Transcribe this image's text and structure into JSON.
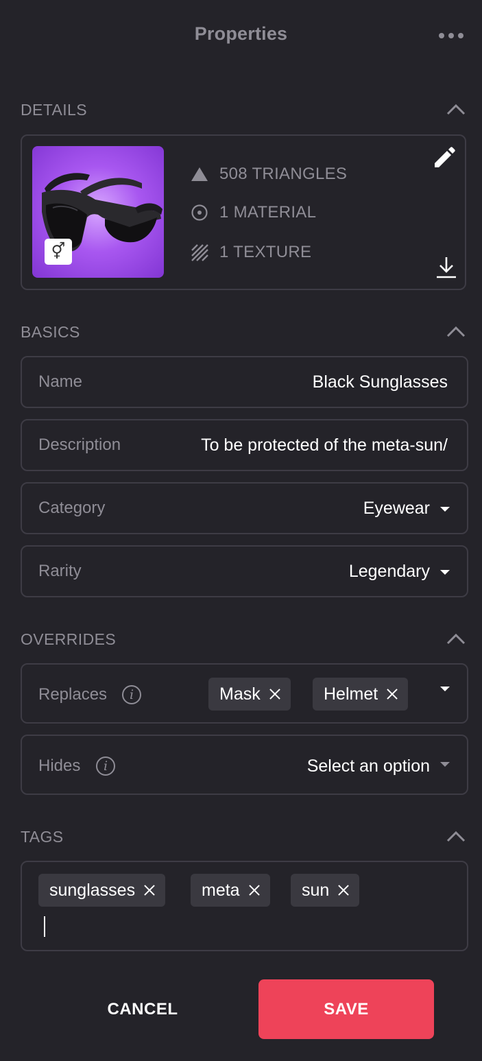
{
  "header": {
    "title": "Properties",
    "more_icon": "more-horizontal-icon"
  },
  "details": {
    "label": "DETAILS",
    "gender_symbol": "⚥",
    "stats": [
      {
        "icon": "triangle-icon",
        "text": "508 TRIANGLES"
      },
      {
        "icon": "material-icon",
        "text": "1 MATERIAL"
      },
      {
        "icon": "texture-icon",
        "text": "1 TEXTURE"
      }
    ],
    "edit_icon": "pencil-icon",
    "download_icon": "download-icon"
  },
  "basics": {
    "label": "BASICS",
    "name": {
      "label": "Name",
      "value": "Black Sunglasses"
    },
    "description": {
      "label": "Description",
      "value": "To be protected of the meta-sun/"
    },
    "category": {
      "label": "Category",
      "value": "Eyewear"
    },
    "rarity": {
      "label": "Rarity",
      "value": "Legendary"
    }
  },
  "overrides": {
    "label": "OVERRIDES",
    "replaces": {
      "label": "Replaces",
      "chips": [
        "Mask",
        "Helmet"
      ]
    },
    "hides": {
      "label": "Hides",
      "placeholder": "Select an option"
    }
  },
  "tags": {
    "label": "TAGS",
    "chips": [
      "sunglasses",
      "meta",
      "sun"
    ]
  },
  "actions": {
    "cancel": "CANCEL",
    "save": "SAVE"
  },
  "colors": {
    "background": "#242329",
    "border": "#3e3c45",
    "muted_text": "#8f8d96",
    "chip_bg": "#3a3940",
    "thumbnail": "#a857f0",
    "save": "#ee4359"
  }
}
